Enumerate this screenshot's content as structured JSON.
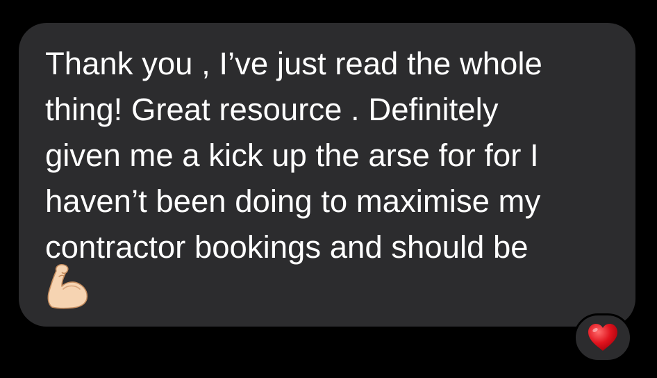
{
  "message": {
    "lines": [
      "Thank you , I’ve just read the whole",
      "thing! Great resource . Definitely",
      "given me a kick up the arse for for I",
      "haven’t been doing to maximise my",
      "contractor bookings and should be"
    ],
    "emoji": "flexed-biceps-icon"
  },
  "reaction": {
    "icon": "heart-icon",
    "color": "#e0141e"
  },
  "colors": {
    "background": "#000000",
    "bubble": "#2c2c2e",
    "text": "#ffffff"
  }
}
